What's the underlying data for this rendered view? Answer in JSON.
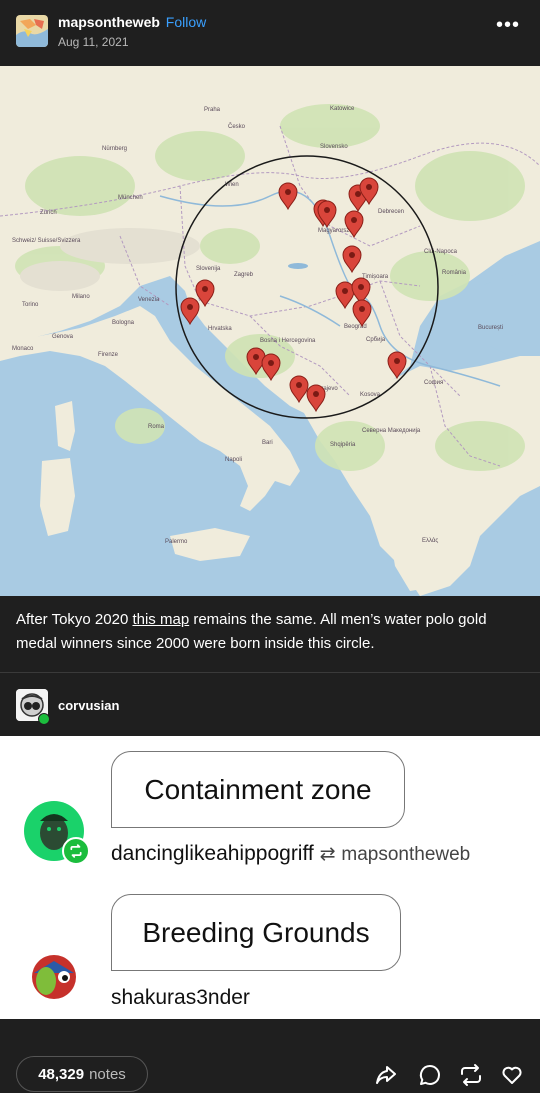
{
  "post": {
    "blog_name": "mapsontheweb",
    "follow_label": "Follow",
    "date": "Aug 11, 2021",
    "more_label": "•••"
  },
  "map": {
    "labels": {
      "wien": "Wien",
      "praha": "Praha",
      "cesko": "Česko",
      "nurnberg": "Nürnberg",
      "munchen": "München",
      "zurich": "Zürich",
      "schweiz": "Schweiz/ Suisse/Svizzera",
      "venezia": "Venezia",
      "milano": "Milano",
      "torino": "Torino",
      "genova": "Genova",
      "bologna": "Bologna",
      "firenze": "Firenze",
      "monaco": "Monaco",
      "roma": "Roma",
      "napoli": "Napoli",
      "bari": "Bari",
      "palermo": "Palermo",
      "zagreb": "Zagreb",
      "slovenija": "Slovenija",
      "hrvatska": "Hrvatska",
      "bosna": "Bosna i Hercegovina",
      "srbija": "Србија",
      "beograd": "Beograd",
      "budapest": "Magyarorszá",
      "slovensko": "Slovensko",
      "katowice": "Katowice",
      "debrecen": "Debrecen",
      "cluj": "Cluj-Napoca",
      "romania": "România",
      "bucuresti": "București",
      "sofia": "София",
      "kosovo": "Kosova",
      "shqiperia": "Shqipëria",
      "makedonija": "Северна Македонија",
      "ellas": "Ελλάς",
      "timisoara": "Timișoara",
      "sarajevo": "Sarajevo"
    }
  },
  "caption": {
    "before": "After Tokyo 2020 ",
    "link": "this map",
    "after": " remains the same. All men’s water polo gold medal winners since 2000 were born inside this circle."
  },
  "reblog": {
    "name": "corvusian"
  },
  "replies": [
    {
      "quote": "Containment zone",
      "user": "dancinglikeahippogriff",
      "rb_from": "mapsontheweb"
    },
    {
      "quote": "Breeding Grounds",
      "user": "shakuras3nder"
    }
  ],
  "footer": {
    "notes_count": "48,329",
    "notes_label": "notes"
  },
  "colors": {
    "background": "#1f1f1f",
    "follow": "#3aa0ff",
    "reblog_green": "#1bbd3d",
    "marker_red": "#d9453b"
  },
  "icons": [
    "more-icon",
    "share-icon",
    "comment-icon",
    "reblog-icon",
    "heart-icon"
  ]
}
